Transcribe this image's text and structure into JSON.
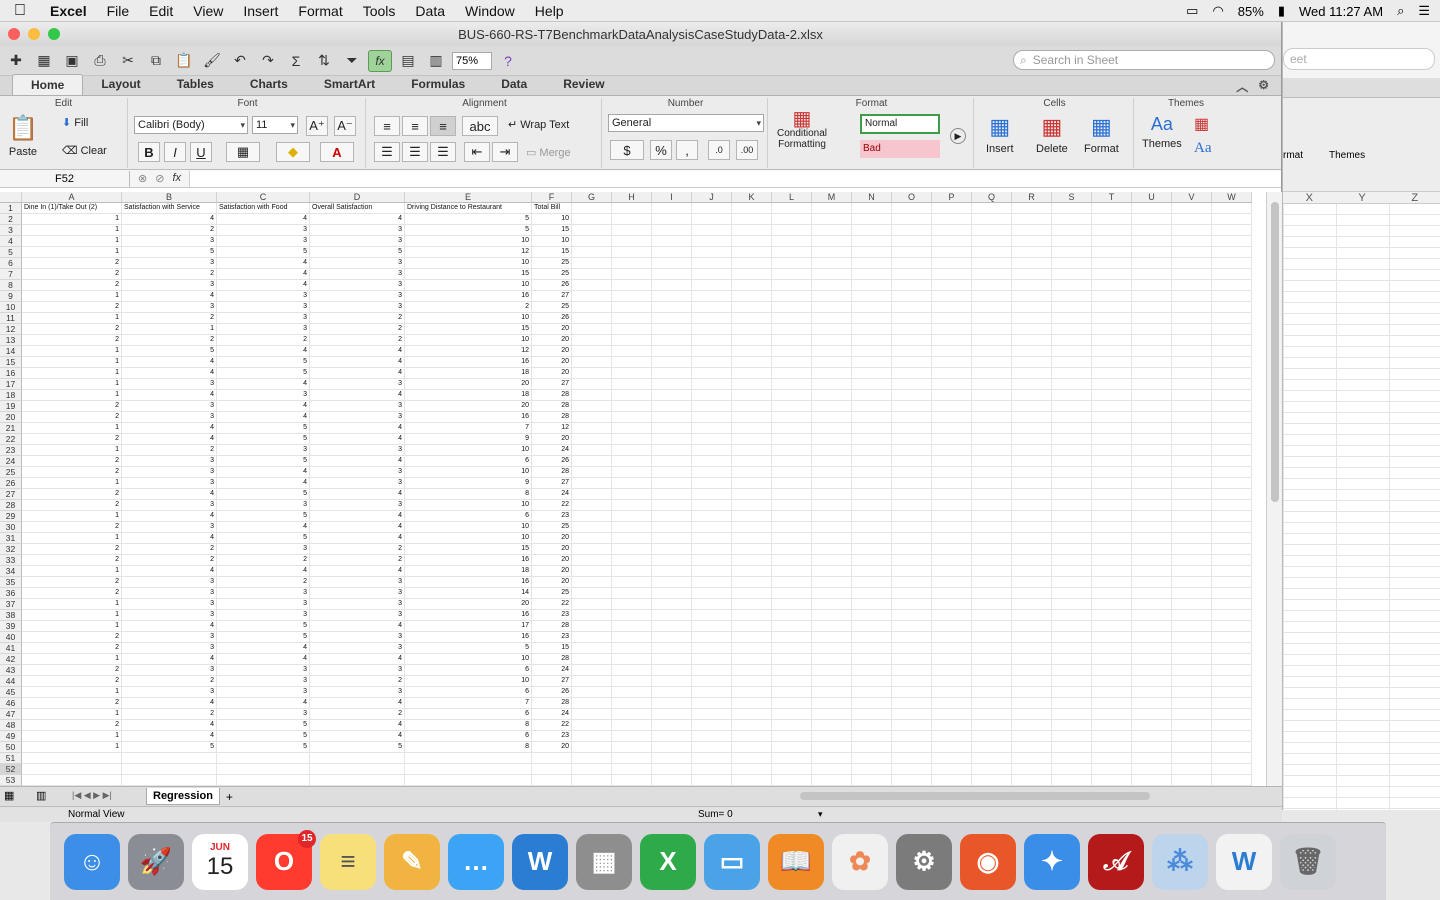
{
  "menubar": {
    "apple": "",
    "items": [
      "Excel",
      "File",
      "Edit",
      "View",
      "Insert",
      "Format",
      "Tools",
      "Data",
      "Window",
      "Help"
    ],
    "battery": "85%",
    "clock": "Wed 11:27 AM"
  },
  "window": {
    "title": "BUS-660-RS-T7BenchmarkDataAnalysisCaseStudyData-2.xlsx",
    "zoom": "75%",
    "search_placeholder": "Search in Sheet"
  },
  "ribbon_tabs": [
    "Home",
    "Layout",
    "Tables",
    "Charts",
    "SmartArt",
    "Formulas",
    "Data",
    "Review"
  ],
  "ribbon": {
    "edit_group": "Edit",
    "paste": "Paste",
    "fill": "Fill",
    "clear": "Clear",
    "font_group": "Font",
    "font_name": "Calibri (Body)",
    "font_size": "11",
    "alignment_group": "Alignment",
    "wrap_text": "Wrap Text",
    "merge": "Merge",
    "abc": "abc",
    "number_group": "Number",
    "number_format": "General",
    "format_group": "Format",
    "conditional_formatting": "Conditional Formatting",
    "style_normal": "Normal",
    "style_bad": "Bad",
    "cells_group": "Cells",
    "insert": "Insert",
    "delete": "Delete",
    "format": "Format",
    "themes_group": "Themes",
    "themes": "Themes",
    "aa": "Aa"
  },
  "formula_bar": {
    "name_box": "F52",
    "fx": "fx",
    "content": ""
  },
  "columns": [
    "A",
    "B",
    "C",
    "D",
    "E",
    "F",
    "G",
    "H",
    "I",
    "J",
    "K",
    "L",
    "M",
    "N",
    "O",
    "P",
    "Q",
    "R",
    "S",
    "T",
    "U",
    "V",
    "W"
  ],
  "headers": [
    "Dine In (1)/Take Out (2)",
    "Satisfaction with Service",
    "Satisfaction with Food",
    "Overall Satisfaction",
    "Driving Distance to Restaurant",
    "Total Bill"
  ],
  "rows": [
    [
      1,
      4,
      4,
      4,
      5,
      10
    ],
    [
      1,
      2,
      3,
      3,
      5,
      15
    ],
    [
      1,
      3,
      3,
      3,
      10,
      10
    ],
    [
      1,
      5,
      5,
      5,
      12,
      15
    ],
    [
      2,
      3,
      4,
      3,
      10,
      25
    ],
    [
      2,
      2,
      4,
      3,
      15,
      25
    ],
    [
      2,
      3,
      4,
      3,
      10,
      26
    ],
    [
      1,
      4,
      3,
      3,
      16,
      27
    ],
    [
      2,
      3,
      3,
      3,
      2,
      25
    ],
    [
      1,
      2,
      3,
      2,
      10,
      26
    ],
    [
      2,
      1,
      3,
      2,
      15,
      20
    ],
    [
      2,
      2,
      2,
      2,
      10,
      20
    ],
    [
      1,
      5,
      4,
      4,
      12,
      20
    ],
    [
      1,
      4,
      5,
      4,
      16,
      20
    ],
    [
      1,
      4,
      5,
      4,
      18,
      20
    ],
    [
      1,
      3,
      4,
      3,
      20,
      27
    ],
    [
      1,
      4,
      3,
      4,
      18,
      28
    ],
    [
      2,
      3,
      4,
      3,
      20,
      28
    ],
    [
      2,
      3,
      4,
      3,
      16,
      28
    ],
    [
      1,
      4,
      5,
      4,
      7,
      12
    ],
    [
      2,
      4,
      5,
      4,
      9,
      20
    ],
    [
      1,
      2,
      3,
      3,
      10,
      24
    ],
    [
      2,
      3,
      5,
      4,
      6,
      26
    ],
    [
      2,
      3,
      4,
      3,
      10,
      28
    ],
    [
      1,
      3,
      4,
      3,
      9,
      27
    ],
    [
      2,
      4,
      5,
      4,
      8,
      24
    ],
    [
      2,
      3,
      3,
      3,
      10,
      22
    ],
    [
      1,
      4,
      5,
      4,
      6,
      23
    ],
    [
      2,
      3,
      4,
      4,
      10,
      25
    ],
    [
      1,
      4,
      5,
      4,
      10,
      20
    ],
    [
      2,
      2,
      3,
      2,
      15,
      20
    ],
    [
      2,
      2,
      2,
      2,
      16,
      20
    ],
    [
      1,
      4,
      4,
      4,
      18,
      20
    ],
    [
      2,
      3,
      2,
      3,
      16,
      20
    ],
    [
      2,
      3,
      3,
      3,
      14,
      25
    ],
    [
      1,
      3,
      3,
      3,
      20,
      22
    ],
    [
      1,
      3,
      3,
      3,
      16,
      23
    ],
    [
      1,
      4,
      5,
      4,
      17,
      28
    ],
    [
      2,
      3,
      5,
      3,
      16,
      23
    ],
    [
      2,
      3,
      4,
      3,
      5,
      15
    ],
    [
      1,
      4,
      4,
      4,
      10,
      28
    ],
    [
      2,
      3,
      3,
      3,
      6,
      24
    ],
    [
      2,
      2,
      3,
      2,
      10,
      27
    ],
    [
      1,
      3,
      3,
      3,
      6,
      26
    ],
    [
      2,
      4,
      4,
      4,
      7,
      28
    ],
    [
      1,
      2,
      3,
      2,
      6,
      24
    ],
    [
      2,
      4,
      5,
      4,
      8,
      22
    ],
    [
      1,
      4,
      5,
      4,
      6,
      23
    ],
    [
      1,
      5,
      5,
      5,
      8,
      20
    ]
  ],
  "sheet_tab": "Regression",
  "status": {
    "view": "Normal View",
    "sum": "Sum= 0"
  },
  "bg_window": {
    "columns": [
      "X",
      "Y",
      "Z"
    ],
    "tab_partial": "rmat",
    "themes": "Themes",
    "search_partial": "eet"
  },
  "dock": {
    "calendar_month": "JUN",
    "calendar_day": "15",
    "opera_badge": "15",
    "colors": {
      "finder": "#3d8ee6",
      "launchpad": "#8a8d93",
      "opera": "#ff3b2f",
      "notes": "#f7e07a",
      "pages": "#f2b441",
      "messages": "#3ba4f5",
      "word": "#2b7cd3",
      "calculator": "#8e8e8e",
      "excel": "#2faa4a",
      "keynote": "#4aa3e6",
      "ibooks": "#f08a24",
      "photos": "#f0f0f0",
      "prefs": "#7b7b7b",
      "firefox": "#e8572a",
      "safari": "#3a8ee8",
      "acrobat": "#b51a1a",
      "downloads": "#bcd4ec",
      "doc": "#f2f2f2",
      "trash": "#cfd3d8"
    }
  }
}
